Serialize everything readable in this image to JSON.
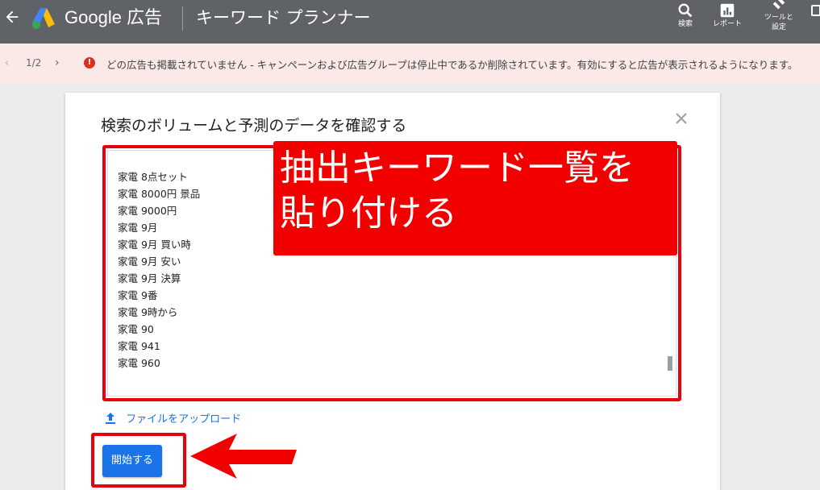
{
  "topbar": {
    "brand": "Google 広告",
    "product_title": "キーワード プランナー",
    "tools": [
      {
        "label": "検索",
        "icon": "search-icon"
      },
      {
        "label": "レポート",
        "icon": "reports-icon"
      },
      {
        "label_line1": "ツールと",
        "label_line2": "設定",
        "icon": "wrench-icon"
      }
    ]
  },
  "notification": {
    "pager": "1/2",
    "message": "どの広告も掲載されていません - キャンペーンおよび広告グループは停止中であるか削除されています。有効にすると広告が表示されるようになります。"
  },
  "dialog": {
    "title": "検索のボリュームと予測のデータを確認する",
    "keywords": [
      "家電 8点セット",
      "家電 8000円 景品",
      "家電 9000円",
      "家電 9月",
      "家電 9月 買い時",
      "家電 9月 安い",
      "家電 9月 決算",
      "家電 9番",
      "家電 9時から",
      "家電 90",
      "家電 941",
      "家電 960"
    ],
    "upload_label": "ファイルをアップロード",
    "start_label": "開始する"
  },
  "annotation": {
    "line1": "抽出キーワード一覧を",
    "line2": "貼り付ける"
  },
  "colors": {
    "header": "#5f6368",
    "accent": "#1a73e8",
    "annotation_red": "#f20000",
    "error": "#d93025",
    "notification_bg": "#fbe9e8"
  }
}
